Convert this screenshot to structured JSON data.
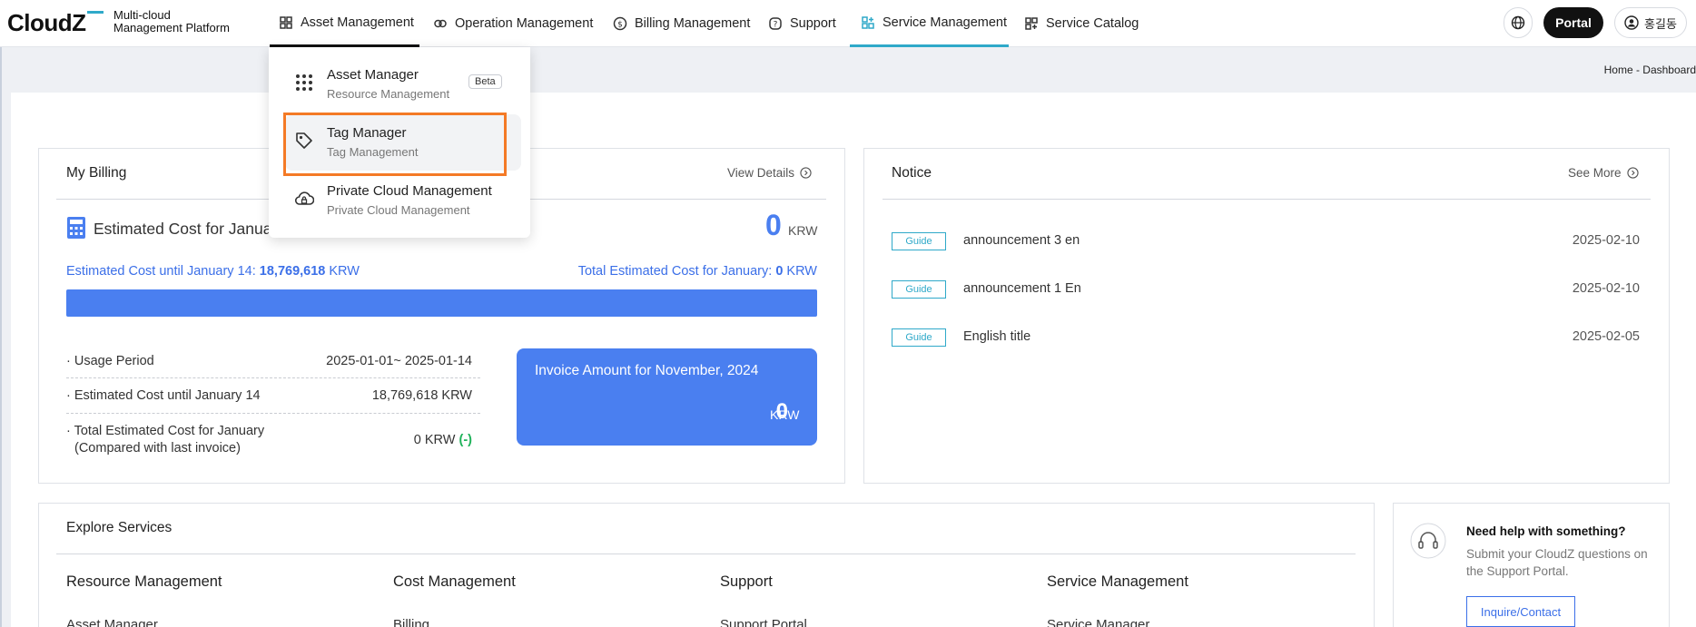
{
  "header": {
    "logo": "CloudZ",
    "logo_sub_line1": "Multi-cloud",
    "logo_sub_line2": "Management Platform",
    "nav": [
      {
        "label": "Asset Management"
      },
      {
        "label": "Operation Management"
      },
      {
        "label": "Billing Management"
      },
      {
        "label": "Support"
      },
      {
        "label": "Service Management"
      },
      {
        "label": "Service Catalog"
      }
    ],
    "portal_label": "Portal",
    "user_name": "홍길동"
  },
  "dropdown": {
    "items": [
      {
        "title": "Asset Manager",
        "subtitle": "Resource Management",
        "badge": "Beta"
      },
      {
        "title": "Tag Manager",
        "subtitle": "Tag Management"
      },
      {
        "title": "Private Cloud Management",
        "subtitle": "Private Cloud Management"
      }
    ]
  },
  "breadcrumb": "Home - Dashboard",
  "billing": {
    "title": "My Billing",
    "view_details": "View Details",
    "estimated_heading": "Estimated Cost for January",
    "big_value": "0",
    "big_unit": "KRW",
    "until_label": "Estimated Cost until January 14:",
    "until_value": "18,769,618",
    "until_unit": "KRW",
    "total_label": "Total Estimated Cost for January:",
    "total_value": "0",
    "total_unit": "KRW",
    "progress_fraction": 1.0,
    "rows": [
      {
        "label": "· Usage Period",
        "value": "2025-01-01~ 2025-01-14"
      },
      {
        "label": "· Estimated Cost until January 14",
        "value": "18,769,618 KRW"
      },
      {
        "label": "· Total Estimated Cost for January",
        "label2": "(Compared with last invoice)",
        "value": "0 KRW",
        "delta": "(-)"
      }
    ],
    "invoice_title": "Invoice Amount for November, 2024",
    "invoice_value": "0",
    "invoice_unit": "KRW"
  },
  "notice": {
    "title": "Notice",
    "see_more": "See More",
    "items": [
      {
        "badge": "Guide",
        "title": "announcement 3 en",
        "date": "2025-02-10"
      },
      {
        "badge": "Guide",
        "title": "announcement 1 En",
        "date": "2025-02-10"
      },
      {
        "badge": "Guide",
        "title": "English title",
        "date": "2025-02-05"
      }
    ]
  },
  "explore": {
    "title": "Explore Services",
    "categories": [
      {
        "name": "Resource Management",
        "first_item": "Asset Manager"
      },
      {
        "name": "Cost Management",
        "first_item": "Billing"
      },
      {
        "name": "Support",
        "first_item": "Support Portal"
      },
      {
        "name": "Service Management",
        "first_item": "Service Manager"
      }
    ]
  },
  "help": {
    "title": "Need help with something?",
    "line1": "Submit your CloudZ questions on",
    "line2": "the Support Portal.",
    "button": "Inquire/Contact"
  },
  "colors": {
    "accent_blue": "#4a7ff0",
    "teal": "#2fa9c9",
    "highlight_orange": "#f47a26",
    "delta_green": "#1fb25a"
  }
}
